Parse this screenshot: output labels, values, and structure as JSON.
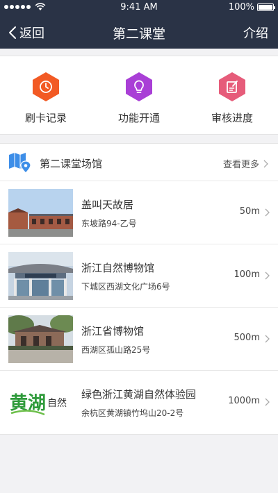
{
  "status_bar": {
    "time": "9:41 AM",
    "battery": "100%"
  },
  "nav": {
    "back_label": "返回",
    "title": "第二课堂",
    "right_label": "介绍"
  },
  "quick_actions": [
    {
      "label": "刷卡记录",
      "icon": "clock-hexagon-icon",
      "color": "#f25a24"
    },
    {
      "label": "功能开通",
      "icon": "bulb-hexagon-icon",
      "color": "#a93fd6"
    },
    {
      "label": "审核进度",
      "icon": "edit-hexagon-icon",
      "color": "#e65c7a"
    }
  ],
  "venues": {
    "title": "第二课堂场馆",
    "more_label": "查看更多",
    "items": [
      {
        "name": "盖叫天故居",
        "address": "东坡路94-乙号",
        "distance": "50m"
      },
      {
        "name": "浙江自然博物馆",
        "address": "下城区西湖文化广场6号",
        "distance": "100m"
      },
      {
        "name": "浙江省博物馆",
        "address": "西湖区孤山路25号",
        "distance": "500m"
      },
      {
        "name": "绿色浙江黄湖自然体验园",
        "address": "余杭区黄湖镇竹坞山20-2号",
        "distance": "1000m",
        "logo_text": "黄湖自然"
      }
    ]
  },
  "colors": {
    "nav_bg": "#2a3346",
    "page_bg": "#f2f2f4",
    "map_icon": "#3d8ee8"
  }
}
